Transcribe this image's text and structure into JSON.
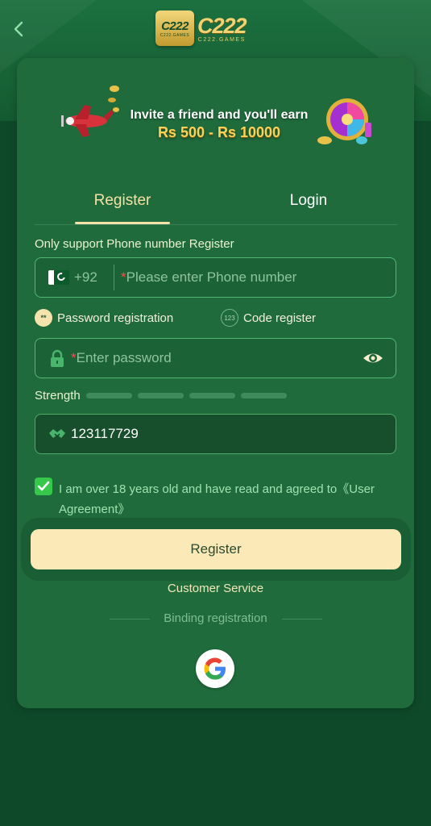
{
  "brand": {
    "logo_badge_text": "C222",
    "logo_badge_sub": "C222.GAMES",
    "logo_word": "C222",
    "logo_word_sub": "C222.GAMES"
  },
  "banner": {
    "line1": "Invite a friend and you'll earn",
    "line2": "Rs 500 - Rs 10000"
  },
  "tabs": [
    {
      "label": "Register",
      "active": true
    },
    {
      "label": "Login",
      "active": false
    }
  ],
  "form": {
    "section_label": "Only support Phone number Register",
    "phone": {
      "country_code": "+92",
      "required_mark": "*",
      "placeholder": "Please enter Phone number"
    },
    "modes": [
      {
        "icon_text": "**",
        "label": "Password registration",
        "selected": true
      },
      {
        "icon_text": "123",
        "label": "Code register",
        "selected": false
      }
    ],
    "password": {
      "required_mark": "*",
      "placeholder": "Enter password"
    },
    "strength_label": "Strength",
    "invite_code": "123117729",
    "agreement": {
      "checked": true,
      "text": "I am over 18 years old and have read and agreed to",
      "link": "《User Agreement》"
    },
    "submit_label": "Register"
  },
  "footer": {
    "customer_service": "Customer Service",
    "binding_label": "Binding registration"
  },
  "colors": {
    "background": "#0e4a2a",
    "card": "#1f6b3c",
    "accent_gold": "#f6d35b",
    "button": "#fbeab8",
    "checkbox": "#35c84b"
  },
  "icons": [
    "back-chevron-icon",
    "pakistan-flag-icon",
    "lock-icon",
    "eye-icon",
    "handshake-icon",
    "check-icon",
    "google-icon"
  ]
}
